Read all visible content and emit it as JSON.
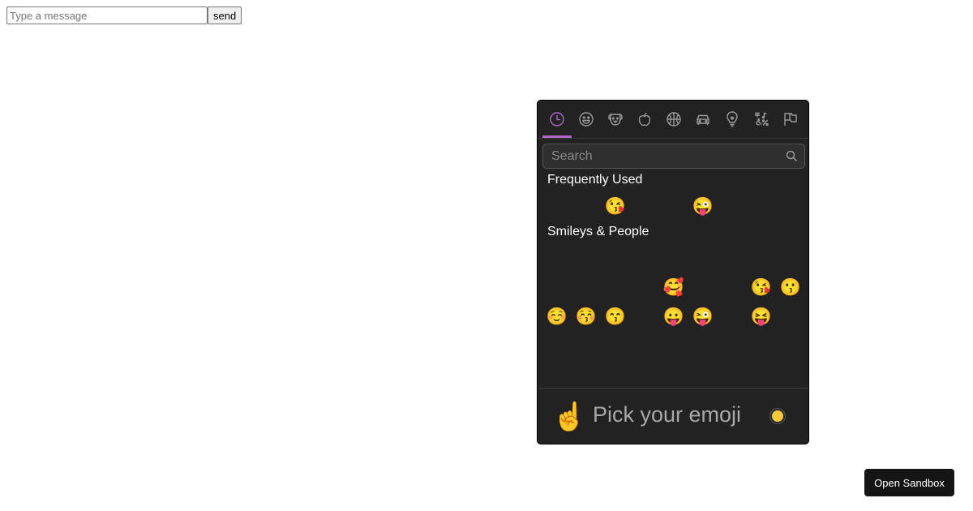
{
  "compose": {
    "placeholder": "Type a message",
    "send_label": "send"
  },
  "picker": {
    "accent_color": "#ae65c5",
    "tabs": [
      {
        "icon": "clock-icon",
        "selected": true
      },
      {
        "icon": "smiley-icon"
      },
      {
        "icon": "dog-icon"
      },
      {
        "icon": "apple-icon"
      },
      {
        "icon": "basketball-icon"
      },
      {
        "icon": "car-icon"
      },
      {
        "icon": "lightbulb-icon"
      },
      {
        "icon": "symbols-icon"
      },
      {
        "icon": "flags-icon"
      }
    ],
    "search_placeholder": "Search",
    "frequently_used_label": "Frequently Used",
    "frequently_used": [
      "😘",
      "😜"
    ],
    "smileys_label": "Smileys & People",
    "smileys_row1": [
      "🥰",
      "😘",
      "😗"
    ],
    "smileys_row2": [
      "☺️",
      "😚",
      "😙",
      "😛",
      "😜",
      "😝"
    ],
    "preview_emoji": "☝️",
    "preview_title": "Pick your emoji",
    "skin_tone_color": "#ffc93a"
  },
  "sandbox_label": "Open Sandbox"
}
